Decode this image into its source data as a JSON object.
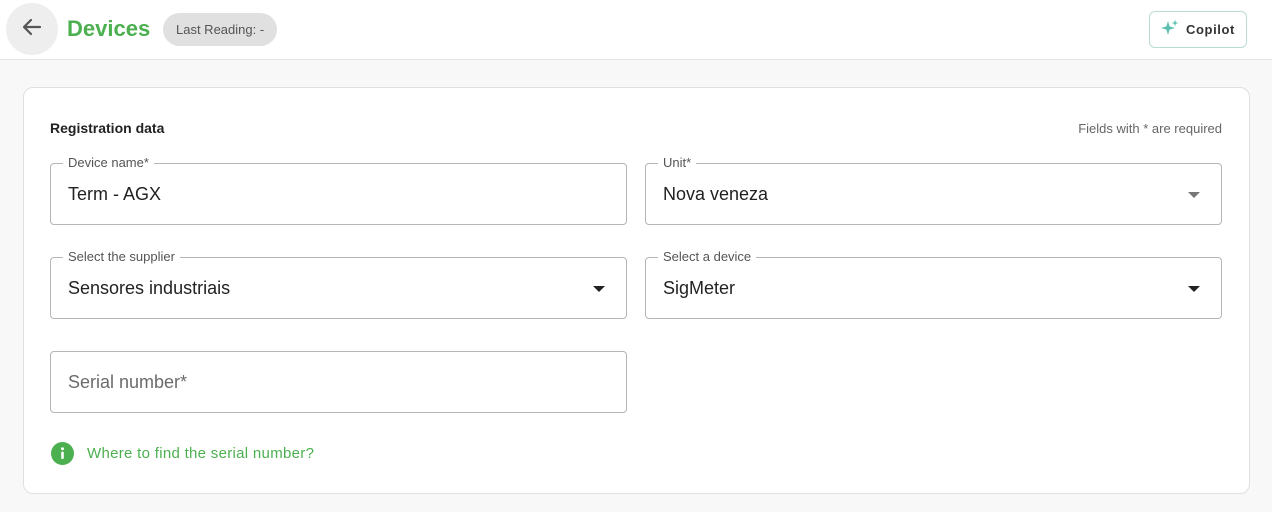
{
  "header": {
    "back_icon": "arrow-left-icon",
    "title": "Devices",
    "last_reading": "Last Reading: -",
    "copilot_label": "Copilot",
    "copilot_icon": "sparkles-icon",
    "title_color": "#4caf50"
  },
  "form": {
    "section_title": "Registration data",
    "required_note": "Fields with * are required",
    "device_name": {
      "label": "Device name*",
      "value": "Term - AGX"
    },
    "unit": {
      "label": "Unit*",
      "value": "Nova veneza"
    },
    "supplier": {
      "label": "Select the supplier",
      "value": "Sensores industriais"
    },
    "device": {
      "label": "Select a device",
      "value": "SigMeter"
    },
    "serial_number": {
      "placeholder": "Serial number*",
      "value": ""
    },
    "help_link": "Where to find the serial number?",
    "help_icon": "info-icon"
  }
}
